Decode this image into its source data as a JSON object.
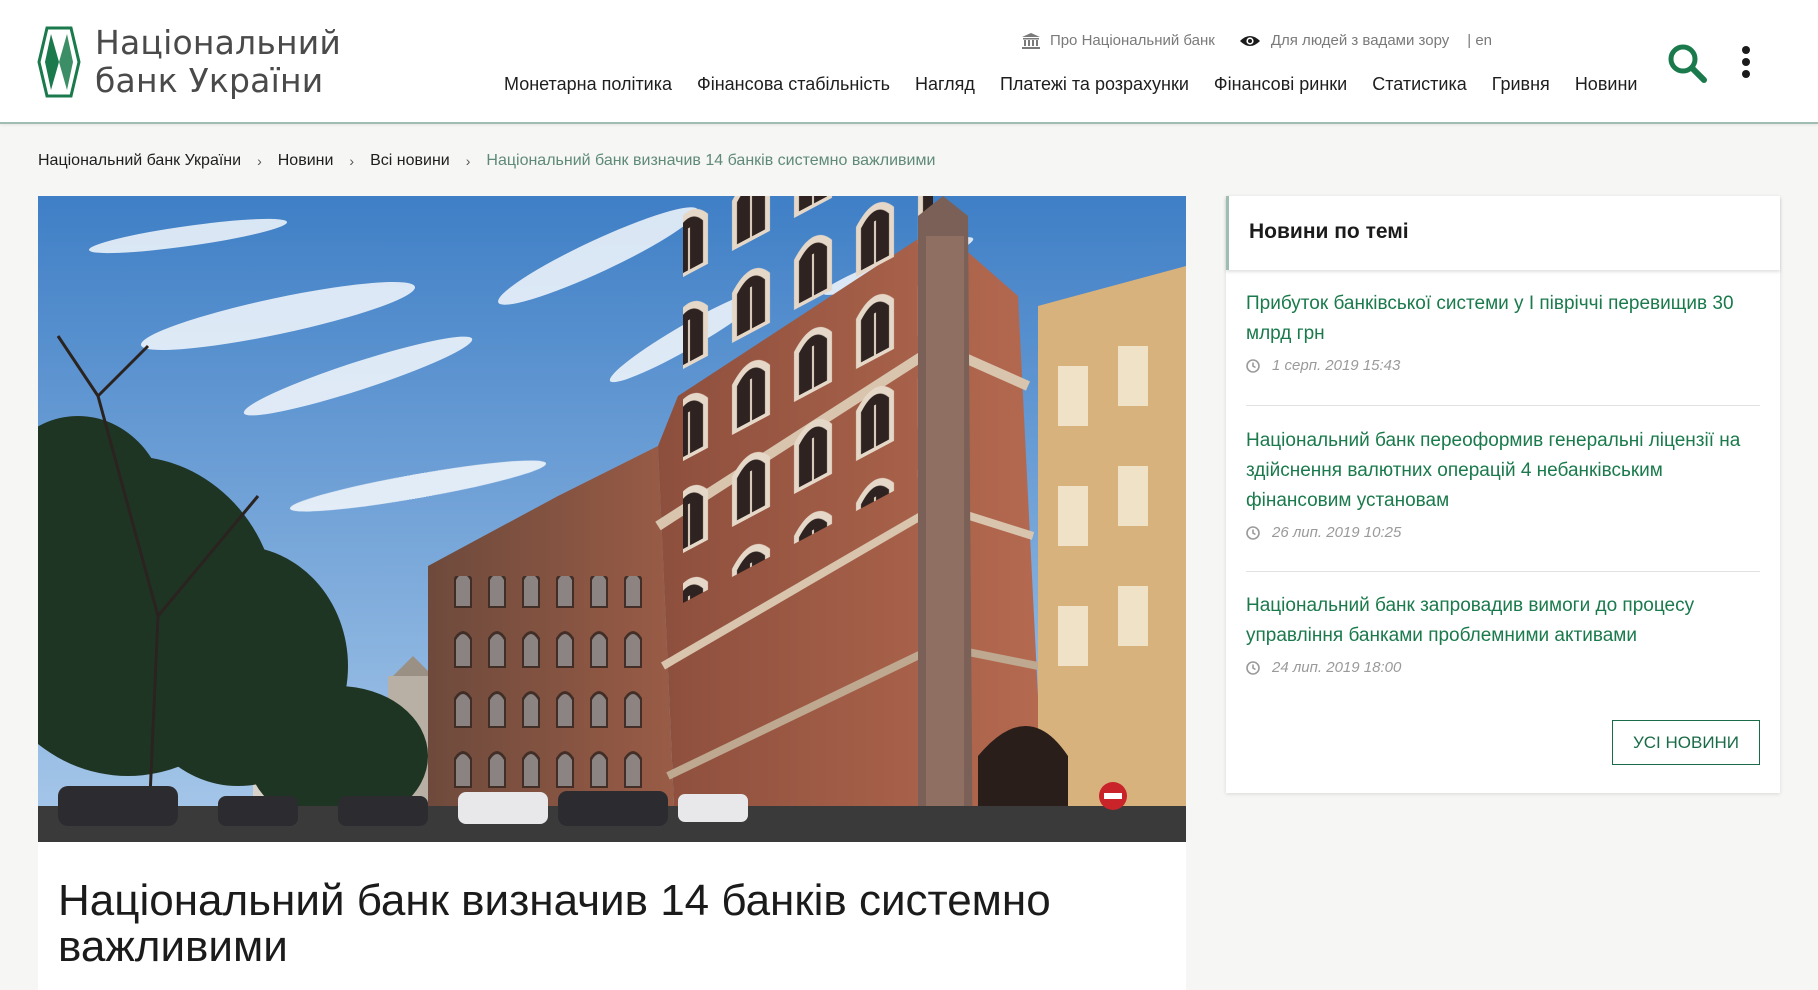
{
  "logo": {
    "line1": "Національний",
    "line2": "банк України"
  },
  "top_links": {
    "about": "Про Національний банк",
    "accessibility": "Для людей з вадами зору",
    "lang": "| en"
  },
  "nav": [
    "Монетарна політика",
    "Фінансова стабільність",
    "Нагляд",
    "Платежі та розрахунки",
    "Фінансові ринки",
    "Статистика",
    "Гривня",
    "Новини"
  ],
  "breadcrumb": {
    "items": [
      "Національний банк України",
      "Новини",
      "Всі новини"
    ],
    "current": "Національний банк визначив 14 банків системно важливими",
    "separator": "›"
  },
  "article": {
    "title": "Національний банк визначив 14 банків системно важливими"
  },
  "sidebar": {
    "heading": "Новини по темі",
    "news": [
      {
        "title": "Прибуток банківської системи у І півріччі перевищив 30 млрд грн",
        "date": "1 серп. 2019 15:43"
      },
      {
        "title": "Національний банк переоформив генеральні ліцензії на здійснення валютних операцій 4 небанківським фінансовим установам",
        "date": "26 лип. 2019 10:25"
      },
      {
        "title": "Національний банк запровадив вимоги до процесу управління банками проблемними активами",
        "date": "24 лип. 2019 18:00"
      }
    ],
    "all_news_button": "УСІ НОВИНИ"
  },
  "colors": {
    "accent_green": "#1a7a4c",
    "header_border": "#9fbdb0",
    "breadcrumb_current": "#5f8a78"
  },
  "icons": [
    "building-icon",
    "eye-icon",
    "search-icon",
    "more-vertical-icon",
    "clock-icon"
  ]
}
